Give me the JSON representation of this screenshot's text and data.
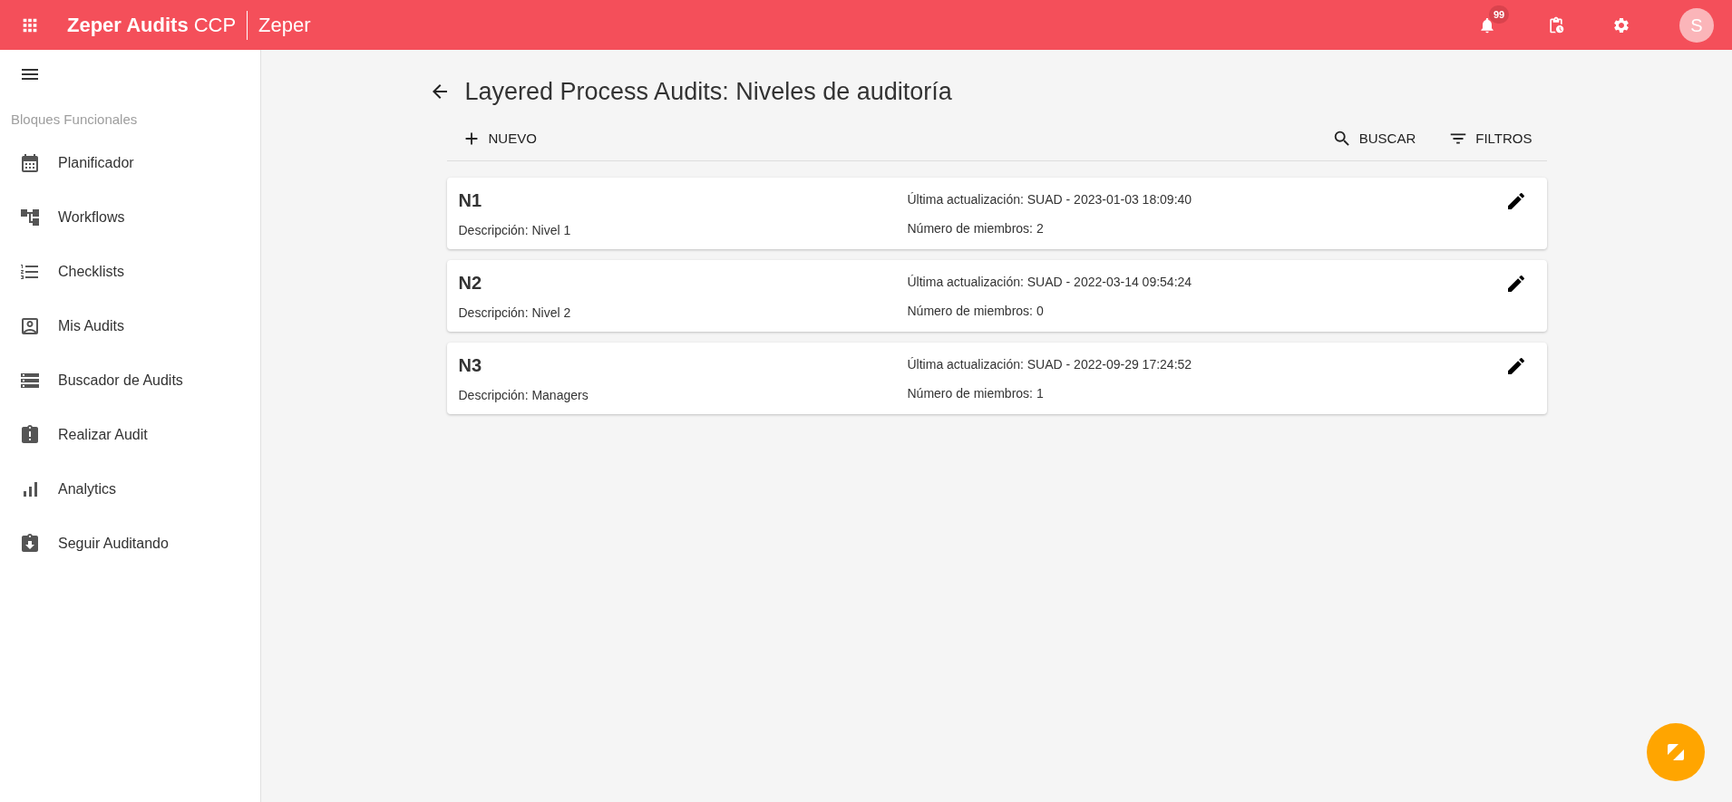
{
  "app_bar": {
    "brand": "Zeper Audits",
    "brand_suffix": "CCP",
    "company": "Zeper",
    "notification_count": "99",
    "avatar_initial": "S"
  },
  "sidebar": {
    "section_title": "Bloques Funcionales",
    "items": [
      {
        "kind": "calendar",
        "label": "Planificador"
      },
      {
        "kind": "workflow",
        "label": "Workflows"
      },
      {
        "kind": "numbered-list",
        "label": "Checklists"
      },
      {
        "kind": "person-box",
        "label": "Mis Audits"
      },
      {
        "kind": "storage",
        "label": "Buscador de Audits"
      },
      {
        "kind": "clipboard-alert",
        "label": "Realizar Audit"
      },
      {
        "kind": "bars",
        "label": "Analytics"
      },
      {
        "kind": "clipboard-down",
        "label": "Seguir Auditando"
      }
    ]
  },
  "page": {
    "title": "Layered Process Audits: Niveles de auditoría",
    "toolbar": {
      "new": "NUEVO",
      "search": "BUSCAR",
      "filters": "FILTROS"
    }
  },
  "levels": [
    {
      "name": "N1",
      "description": "Descripción: Nivel 1",
      "updated": "Última actualización: SUAD - 2023-01-03 18:09:40",
      "members": "Número de miembros: 2"
    },
    {
      "name": "N2",
      "description": "Descripción: Nivel 2",
      "updated": "Última actualización: SUAD - 2022-03-14 09:54:24",
      "members": "Número de miembros: 0"
    },
    {
      "name": "N3",
      "description": "Descripción: Managers",
      "updated": "Última actualización: SUAD - 2022-09-29 17:24:52",
      "members": "Número de miembros: 1"
    }
  ]
}
